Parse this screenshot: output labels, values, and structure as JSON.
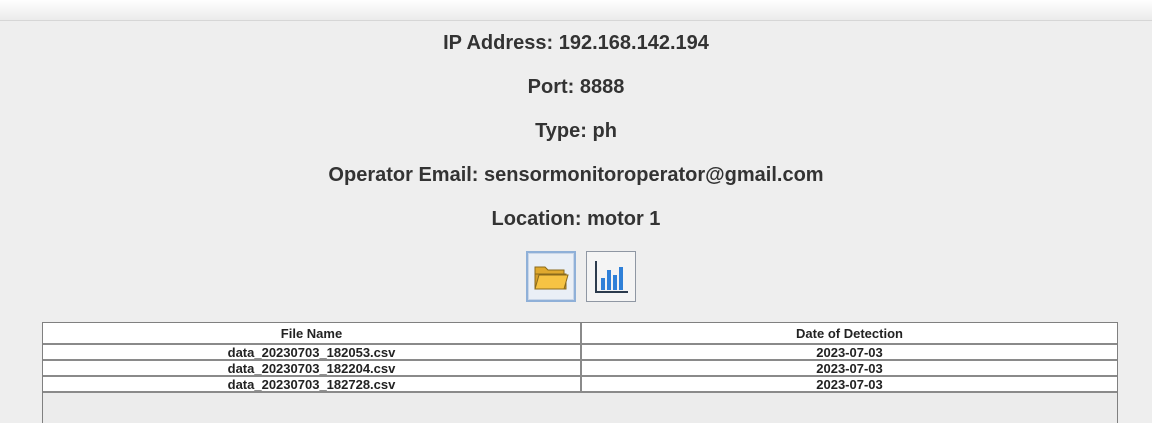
{
  "device_info": {
    "ip_address": "IP Address: 192.168.142.194",
    "port": "Port: 8888",
    "type": "Type: ph",
    "operator_email": "Operator Email: sensormonitoroperator@gmail.com",
    "location": "Location: motor 1"
  },
  "toolbar": {
    "open_folder_icon": "folder-open-icon",
    "chart_icon": "bar-chart-icon"
  },
  "table": {
    "columns": [
      "File Name",
      "Date of Detection"
    ],
    "rows": [
      [
        "data_20230703_182053.csv",
        "2023-07-03"
      ],
      [
        "data_20230703_182204.csv",
        "2023-07-03"
      ],
      [
        "data_20230703_182728.csv",
        "2023-07-03"
      ]
    ]
  },
  "colors": {
    "background": "#eeeeee",
    "folder_yellow": "#f6c343",
    "chart_blue": "#2f80d8"
  }
}
